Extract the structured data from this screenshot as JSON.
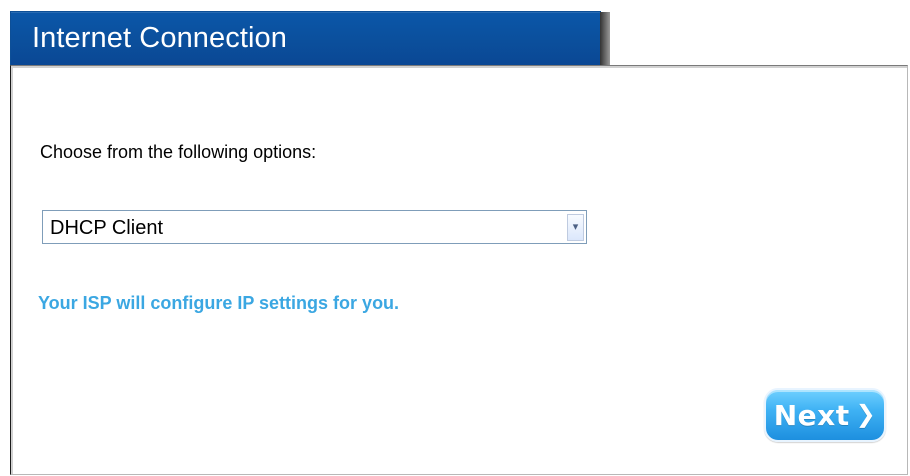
{
  "header": {
    "title": "Internet Connection"
  },
  "content": {
    "instruction": "Choose from the following options:",
    "connection_type": {
      "selected_value": "DHCP Client",
      "icon": "chevron-down-icon"
    },
    "description": "Your ISP will configure IP settings for you."
  },
  "actions": {
    "next_label": "Next",
    "next_icon": "chevron-right-icon"
  },
  "colors": {
    "header_blue": "#0b4f9c",
    "description_blue": "#3ba7e2",
    "button_blue": "#2a9ae8"
  }
}
